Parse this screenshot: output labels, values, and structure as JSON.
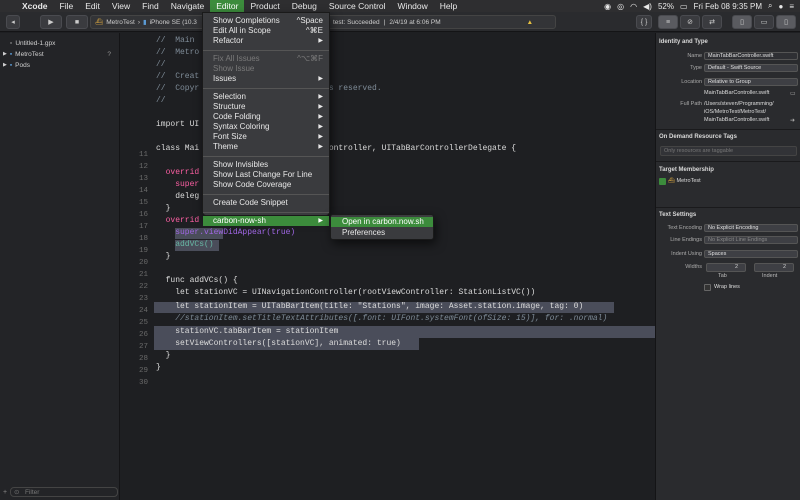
{
  "menubar": {
    "app": "Xcode",
    "items": [
      "File",
      "Edit",
      "View",
      "Find",
      "Navigate",
      "Editor",
      "Product",
      "Debug",
      "Source Control",
      "Window",
      "Help"
    ],
    "battery": "52%",
    "clock": "Fri Feb 08  9:35 PM"
  },
  "toolbar": {
    "scheme": "MetroTest",
    "device": "iPhone SE (10.3",
    "activity_status": "test: Succeeded",
    "activity_date": "2/4/19 at 6:06 PM"
  },
  "navigator": {
    "items": [
      "Untitled-1.gpx",
      "MetroTest",
      "Pods"
    ],
    "metrotest_badge": "?",
    "filter_placeholder": "Filter"
  },
  "editor": {
    "lines": [
      {
        "n": "",
        "t": "//  Main"
      },
      {
        "n": "",
        "t": "//  Metro"
      },
      {
        "n": "",
        "t": "//"
      },
      {
        "n": "",
        "t": "//  Creat"
      },
      {
        "n": "",
        "t": "//  Copyr                       ights reserved."
      },
      {
        "n": "",
        "t": "//"
      },
      {
        "n": "",
        "t": ""
      },
      {
        "n": "",
        "t": "import UI"
      },
      {
        "n": "",
        "t": ""
      },
      {
        "n": "11",
        "t": "class Mai                       barController, UITabBarControllerDelegate {"
      },
      {
        "n": "12",
        "t": ""
      },
      {
        "n": "13",
        "t": "  overrid"
      },
      {
        "n": "14",
        "t": "    super"
      },
      {
        "n": "15",
        "t": "    deleg"
      },
      {
        "n": "16",
        "t": "  }"
      },
      {
        "n": "17",
        "t": "  overrid"
      },
      {
        "n": "18",
        "t": "    super.viewDidAppear(true)"
      },
      {
        "n": "19",
        "t": "    addVCs()"
      },
      {
        "n": "20",
        "t": "  }"
      },
      {
        "n": "21",
        "t": ""
      },
      {
        "n": "22",
        "t": "  func addVCs() {"
      },
      {
        "n": "23",
        "t": "    let stationVC = UINavigationController(rootViewController: StationListVC())"
      },
      {
        "n": "24",
        "t": "    let stationItem = UITabBarItem(title: \"Stations\", image: Asset.station.image, tag: 0)"
      },
      {
        "n": "25",
        "t": "    //stationItem.setTitleTextAttributes([.font: UIFont.systemFont(ofSize: 15)], for: .normal)"
      },
      {
        "n": "26",
        "t": "    stationVC.tabBarItem = stationItem"
      },
      {
        "n": "27",
        "t": "    setViewControllers([stationVC], animated: true)"
      },
      {
        "n": "28",
        "t": "  }"
      },
      {
        "n": "29",
        "t": "}"
      },
      {
        "n": "30",
        "t": ""
      }
    ]
  },
  "editor_menu": {
    "items": [
      {
        "label": "Show Completions",
        "shortcut": "^Space"
      },
      {
        "label": "Edit All in Scope",
        "shortcut": "^⌘E"
      },
      {
        "label": "Refactor",
        "arrow": "▶"
      },
      {
        "label": "Fix All Issues",
        "shortcut": "^⌥⌘F",
        "disabled": true
      },
      {
        "label": "Show Issue",
        "disabled": true
      },
      {
        "label": "Issues",
        "arrow": "▶"
      },
      {
        "label": "Selection",
        "arrow": "▶"
      },
      {
        "label": "Structure",
        "arrow": "▶"
      },
      {
        "label": "Code Folding",
        "arrow": "▶"
      },
      {
        "label": "Syntax Coloring",
        "arrow": "▶"
      },
      {
        "label": "Font Size",
        "arrow": "▶"
      },
      {
        "label": "Theme",
        "arrow": "▶"
      },
      {
        "label": "Show Invisibles"
      },
      {
        "label": "Show Last Change For Line"
      },
      {
        "label": "Show Code Coverage"
      },
      {
        "label": "Create Code Snippet"
      },
      {
        "label": "carbon-now-sh",
        "arrow": "▶",
        "active": true
      }
    ]
  },
  "submenu": {
    "items": [
      "Open in carbon.now.sh",
      "Preferences"
    ]
  },
  "inspector": {
    "identity_header": "Identity and Type",
    "name_label": "Name",
    "name_value": "MainTabBarController.swift",
    "type_label": "Type",
    "type_value": "Default - Swift Source",
    "location_label": "Location",
    "location_value": "Relative to Group",
    "location_file": "MainTabBarController.swift",
    "fullpath_label": "Full Path",
    "fullpath_lines": [
      "/Users/steven/Programming/",
      "iOS/MetroTest/MetroTest/",
      "MainTabBarController.swift"
    ],
    "ondemand_header": "On Demand Resource Tags",
    "ondemand_placeholder": "Only resources are taggable",
    "target_header": "Target Membership",
    "target_item": "MetroTest",
    "text_header": "Text Settings",
    "encoding_label": "Text Encoding",
    "encoding_value": "No Explicit Encoding",
    "endings_label": "Line Endings",
    "endings_value": "No Explicit Line Endings",
    "indent_label": "Indent Using",
    "indent_value": "Spaces",
    "widths_label": "Widths",
    "tab_value": "2",
    "indent_width_value": "2",
    "tab_label": "Tab",
    "indent_label2": "Indent",
    "wrap_label": "Wrap lines"
  }
}
